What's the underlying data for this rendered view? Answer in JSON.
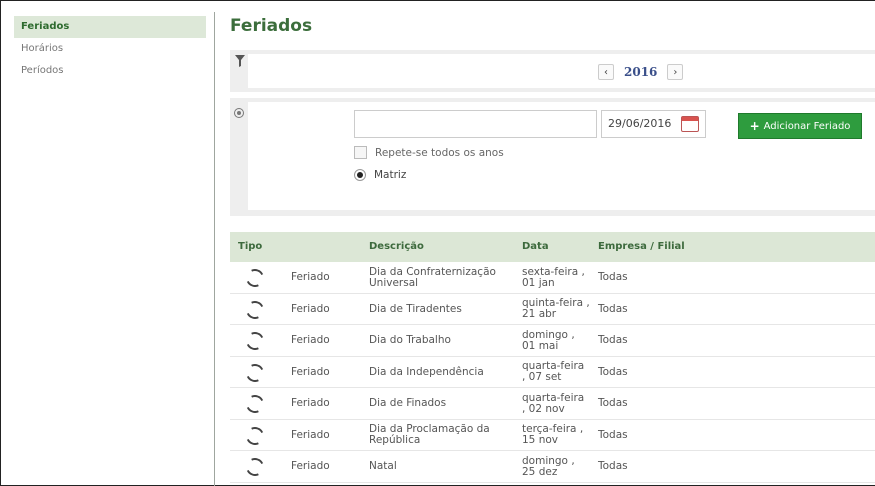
{
  "sidebar": {
    "items": [
      {
        "label": "Feriados",
        "active": true
      },
      {
        "label": "Horários",
        "active": false
      },
      {
        "label": "Períodos",
        "active": false
      }
    ]
  },
  "page": {
    "title": "Feriados"
  },
  "filter": {
    "icon": "funnel-icon",
    "prev_label": "‹",
    "next_label": "›",
    "year": "2016"
  },
  "form": {
    "icon": "add-circle-icon",
    "description_value": "",
    "date_value": "29/06/2016",
    "add_button_label": "Adicionar Feriado",
    "add_button_icon": "+",
    "repeat_label": "Repete-se todos os anos",
    "scope_label": "Matriz"
  },
  "colors": {
    "accent_green": "#3c6e3c",
    "button_green": "#2e9c3e",
    "header_bg": "#dce7d6",
    "year_blue": "#3a4f8a"
  },
  "table": {
    "headers": {
      "tipo": "Tipo",
      "descricao": "Descrição",
      "data": "Data",
      "empresa": "Empresa / Filial"
    },
    "rows": [
      {
        "icon": "refresh-icon",
        "tipo": "Feriado",
        "descricao": "Dia da Confraternização Universal",
        "data": "sexta-feira , 01 jan",
        "empresa": "Todas"
      },
      {
        "icon": "refresh-icon",
        "tipo": "Feriado",
        "descricao": "Dia de Tiradentes",
        "data": "quinta-feira , 21 abr",
        "empresa": "Todas"
      },
      {
        "icon": "refresh-icon",
        "tipo": "Feriado",
        "descricao": "Dia do Trabalho",
        "data": "domingo , 01 mai",
        "empresa": "Todas"
      },
      {
        "icon": "refresh-icon",
        "tipo": "Feriado",
        "descricao": "Dia da Independência",
        "data": "quarta-feira , 07 set",
        "empresa": "Todas"
      },
      {
        "icon": "refresh-icon",
        "tipo": "Feriado",
        "descricao": "Dia de Finados",
        "data": "quarta-feira , 02 nov",
        "empresa": "Todas"
      },
      {
        "icon": "refresh-icon",
        "tipo": "Feriado",
        "descricao": "Dia da Proclamação da República",
        "data": "terça-feira , 15 nov",
        "empresa": "Todas"
      },
      {
        "icon": "refresh-icon",
        "tipo": "Feriado",
        "descricao": "Natal",
        "data": "domingo , 25 dez",
        "empresa": "Todas"
      }
    ]
  }
}
